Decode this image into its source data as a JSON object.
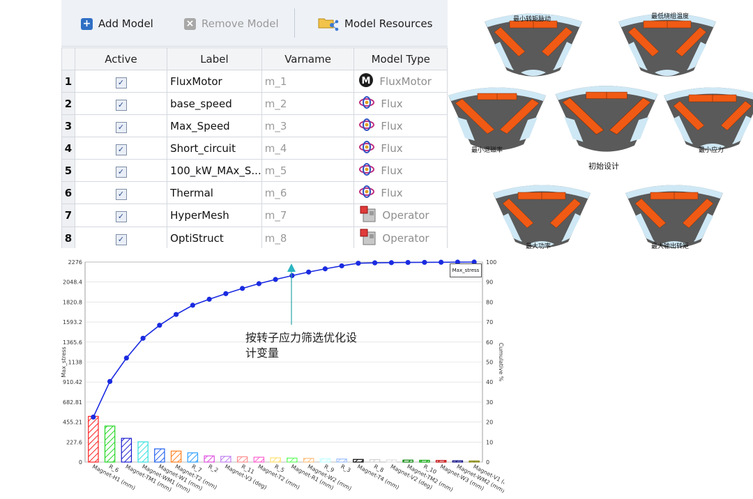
{
  "toolbar": {
    "add_model": "Add Model",
    "remove_model": "Remove Model",
    "model_resources": "Model Resources"
  },
  "table": {
    "headers": [
      "Active",
      "Label",
      "Varname",
      "Model Type"
    ],
    "rows": [
      {
        "num": "1",
        "active": true,
        "label": "FluxMotor",
        "varname": "m_1",
        "type": "FluxMotor",
        "icon": "fluxmotor-icon"
      },
      {
        "num": "2",
        "active": true,
        "label": "base_speed",
        "varname": "m_2",
        "type": "Flux",
        "icon": "flux-icon"
      },
      {
        "num": "3",
        "active": true,
        "label": "Max_Speed",
        "varname": "m_3",
        "type": "Flux",
        "icon": "flux-icon"
      },
      {
        "num": "4",
        "active": true,
        "label": "Short_circuit",
        "varname": "m_4",
        "type": "Flux",
        "icon": "flux-icon"
      },
      {
        "num": "5",
        "active": true,
        "label": "100_kW_MAx_S...",
        "varname": "m_5",
        "type": "Flux",
        "icon": "flux-icon"
      },
      {
        "num": "6",
        "active": true,
        "label": "Thermal",
        "varname": "m_6",
        "type": "Flux",
        "icon": "flux-icon"
      },
      {
        "num": "7",
        "active": true,
        "label": "HyperMesh",
        "varname": "m_7",
        "type": "Operator",
        "icon": "operator-icon"
      },
      {
        "num": "8",
        "active": true,
        "label": "OptiStruct",
        "varname": "m_8",
        "type": "Operator",
        "icon": "operator-icon"
      }
    ]
  },
  "designs": {
    "captions": {
      "min_ripple": "最小转矩脉动",
      "min_temp": "最低绕组温度",
      "min_demag": "最小退磁率",
      "initial": "初始设计",
      "min_stress": "最小应力",
      "max_power": "最大功率",
      "max_torque": "最大输出转矩"
    },
    "colors": {
      "rotor": "#595959",
      "magnet": "#f05a14",
      "air": "#cfe8f5"
    }
  },
  "chart_data": {
    "type": "bar",
    "title": "",
    "ylabel": "Max_stress",
    "y2label": "Cumulative %",
    "legend": "Max_stress",
    "legend_position": "top-right",
    "ylim": [
      0,
      2276
    ],
    "y2lim": [
      0,
      100
    ],
    "yticks": [
      "0",
      "227.6",
      "455.21",
      "682.81",
      "910.42",
      "1138",
      "1365.6",
      "1593.2",
      "1820.8",
      "2048.4",
      "2276"
    ],
    "y2ticks": [
      "0",
      "10",
      "20",
      "30",
      "40",
      "50",
      "60",
      "70",
      "80",
      "90",
      "100"
    ],
    "grid": true,
    "categories": [
      "Magnet-H1 (mm)",
      "R_6",
      "Magnet-TM1 (mm)",
      "Magnet-WM1 (mm)",
      "Magnet-W1 (mm)",
      "Magnet-T2 (mm)",
      "R_7",
      "R_2",
      "Magnet-V3 (deg)",
      "R_11",
      "Magnet-T2 (mm)",
      "R_5",
      "Magnet-R1 (mm)",
      "Magnet-W2 (mm)",
      "R_9",
      "R_3",
      "Magnet-T4 (mm)",
      "R_8",
      "Magnet-V2 (deg)",
      "Magnet-TM2 (mm)",
      "R_10",
      "Magnet-W3 (mm)",
      "Magnet-WM2 (mm)",
      "Magnet-V1 (deg)"
    ],
    "values": [
      520,
      410,
      270,
      230,
      150,
      125,
      105,
      70,
      65,
      60,
      55,
      48,
      45,
      42,
      38,
      35,
      30,
      28,
      25,
      22,
      20,
      18,
      15,
      12
    ],
    "cumulative": [
      22.5,
      40.3,
      52.0,
      61.9,
      68.4,
      73.8,
      78.4,
      81.4,
      84.2,
      86.8,
      89.2,
      91.3,
      93.2,
      95.0,
      96.6,
      98.1,
      99.4,
      99.6,
      99.7,
      99.8,
      99.85,
      99.9,
      99.95,
      100
    ],
    "bar_colors": [
      "#ff2020",
      "#22d622",
      "#1b1bd0",
      "#33e0e0",
      "#2060f0",
      "#ff8020",
      "#30a0ff",
      "#e050e0",
      "#c080f0",
      "#ff9090",
      "#ff60d0",
      "#ffe070",
      "#60ff60",
      "#ffc080",
      "#c0ffff",
      "#a0c0ff",
      "#000000",
      "#d0d0d0",
      "#e0e0e0",
      "#008000",
      "#00a000",
      "#c00000",
      "#000080",
      "#808000"
    ],
    "line_color": "#1a2be0",
    "marker_label": "按转子应力筛选优化设计变量",
    "annotation_lines": [
      "按转子应力筛选优化设",
      "计变量"
    ]
  }
}
